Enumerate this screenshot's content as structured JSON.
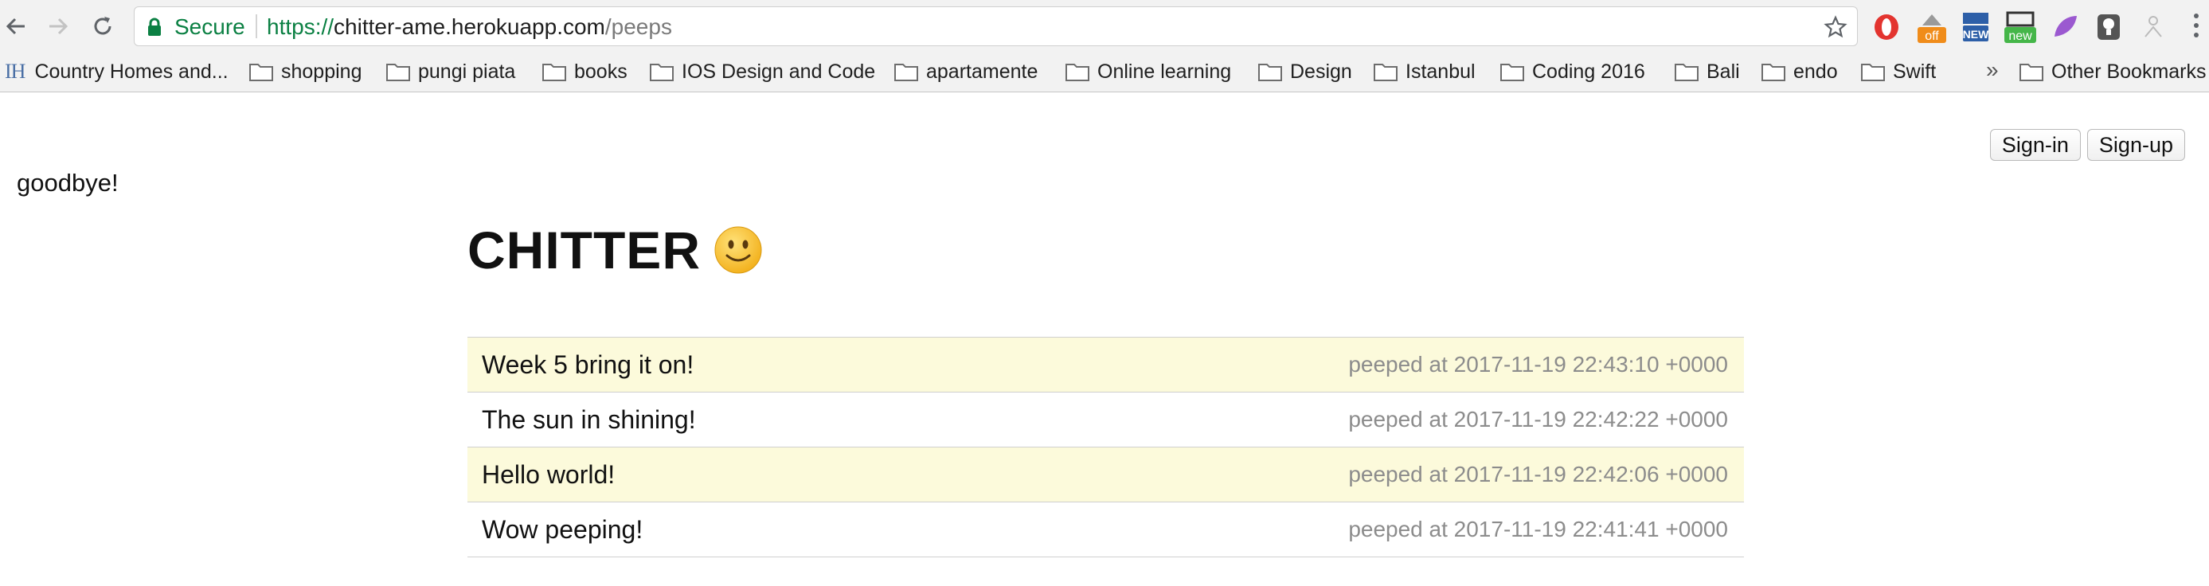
{
  "browser": {
    "secure_label": "Secure",
    "url": {
      "scheme": "https://",
      "host": "chitter-ame.herokuapp.com",
      "path": "/peeps"
    },
    "extensions": [
      {
        "name": "opera-icon",
        "color": "#e3342f"
      },
      {
        "name": "honey-off-icon",
        "label": "off",
        "color": "#f08c1a"
      },
      {
        "name": "new-badge-icon",
        "label": "NEW",
        "color": "#2d5fa8"
      },
      {
        "name": "new-green-icon",
        "label": "new",
        "color": "#45b649"
      },
      {
        "name": "feather-icon",
        "color": "#9b59d0"
      },
      {
        "name": "bulb-icon",
        "color": "#555555"
      },
      {
        "name": "person-icon",
        "color": "#bbbbbb"
      }
    ],
    "bookmarks": [
      "Country Homes and...",
      "shopping",
      "pungi piata",
      "books",
      "IOS Design and Code",
      "apartamente",
      "Online learning",
      "Design",
      "Istanbul",
      "Coding 2016",
      "Bali",
      "endo",
      "Swift"
    ],
    "bookmarks_overflow": "»",
    "other_bookmarks": "Other Bookmarks",
    "first_bookmark_icon": "IH"
  },
  "page": {
    "signin_label": "Sign-in",
    "signup_label": "Sign-up",
    "message": "goodbye!",
    "title": "CHITTER",
    "peeps": [
      {
        "text": "Week 5 bring it on!",
        "time": "peeped at 2017-11-19 22:43:10 +0000"
      },
      {
        "text": "The sun in shining!",
        "time": "peeped at 2017-11-19 22:42:22 +0000"
      },
      {
        "text": "Hello world!",
        "time": "peeped at 2017-11-19 22:42:06 +0000"
      },
      {
        "text": "Wow peeping!",
        "time": "peeped at 2017-11-19 22:41:41 +0000"
      }
    ]
  },
  "colors": {
    "row_highlight": "#fcfadb",
    "secure_green": "#0b8043"
  }
}
